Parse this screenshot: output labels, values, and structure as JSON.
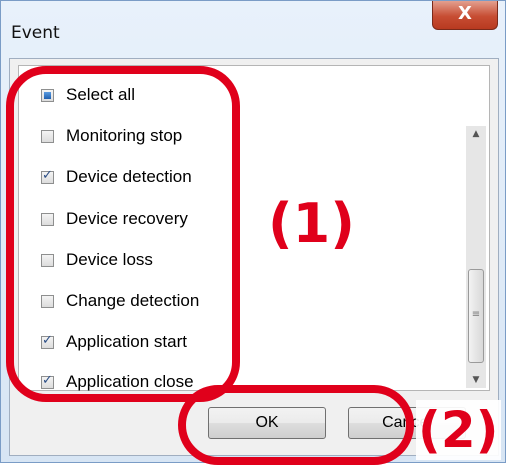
{
  "window": {
    "title": "Event",
    "close_label": "X"
  },
  "events": {
    "items": [
      {
        "label": "Select all",
        "state": "partial"
      },
      {
        "label": "Monitoring stop",
        "state": "unchecked"
      },
      {
        "label": "Device detection",
        "state": "checked"
      },
      {
        "label": "Device recovery",
        "state": "unchecked"
      },
      {
        "label": "Device loss",
        "state": "unchecked"
      },
      {
        "label": "Change detection",
        "state": "unchecked"
      },
      {
        "label": "Application start",
        "state": "checked"
      },
      {
        "label": "Application close",
        "state": "checked"
      }
    ]
  },
  "scrollbar": {
    "up_icon": "arrow-up-icon",
    "down_icon": "arrow-down-icon",
    "up_glyph": "▲",
    "down_glyph": "▼",
    "grip_glyph": "≡"
  },
  "buttons": {
    "ok_label": "OK",
    "cancel_label": "Cancel"
  },
  "annotations": {
    "marker_1": "(1)",
    "marker_2": "(2)",
    "color": "#e0001b"
  }
}
